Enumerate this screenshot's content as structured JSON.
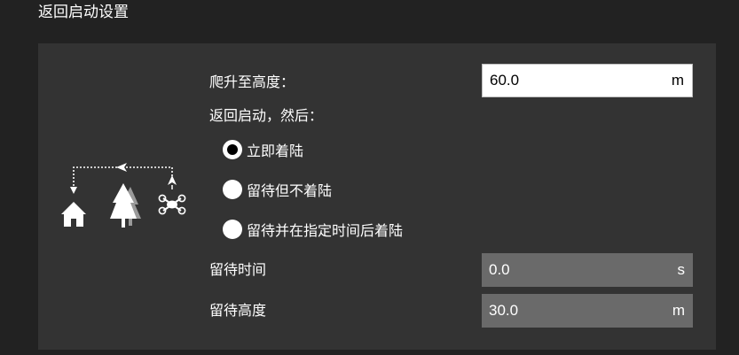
{
  "section_title": "返回启动设置",
  "climb": {
    "label": "爬升至高度：",
    "value": "60.0",
    "unit": "m"
  },
  "after_return_label": "返回启动，然后：",
  "options": [
    {
      "label": "立即着陆",
      "selected": true
    },
    {
      "label": "留待但不着陆",
      "selected": false
    },
    {
      "label": "留待并在指定时间后着陆",
      "selected": false
    }
  ],
  "loiter_time": {
    "label": "留待时间",
    "value": "0.0",
    "unit": "s"
  },
  "loiter_alt": {
    "label": "留待高度",
    "value": "30.0",
    "unit": "m"
  },
  "illustration_icons": [
    "home-icon",
    "trees-icon",
    "drone-icon",
    "return-path-arrow-icon"
  ],
  "colors": {
    "background": "#222222",
    "panel": "#333333",
    "readonly_field": "#6a6a6a",
    "text": "#ffffff"
  }
}
